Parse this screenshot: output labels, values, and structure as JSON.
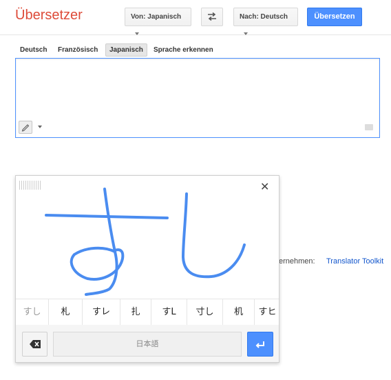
{
  "header": {
    "title": "Übersetzer",
    "from_lang": "Von: Japanisch",
    "to_lang": "Nach: Deutsch",
    "translate_label": "Übersetzen"
  },
  "tabs": [
    "Deutsch",
    "Französisch",
    "Japanisch",
    "Sprache erkennen"
  ],
  "selected_tab": "Japanisch",
  "background": {
    "partial_text": "ernehmen:",
    "link": "Translator Toolkit"
  },
  "handwriting": {
    "candidates": [
      "すし",
      "札",
      "すレ",
      "扎",
      "すL",
      "寸し",
      "机",
      "すヒ"
    ],
    "input_language": "日本語"
  },
  "colors": {
    "brand_red": "#dd4b39",
    "accent_blue": "#4d90fe",
    "ink": "#4a8cf0"
  }
}
